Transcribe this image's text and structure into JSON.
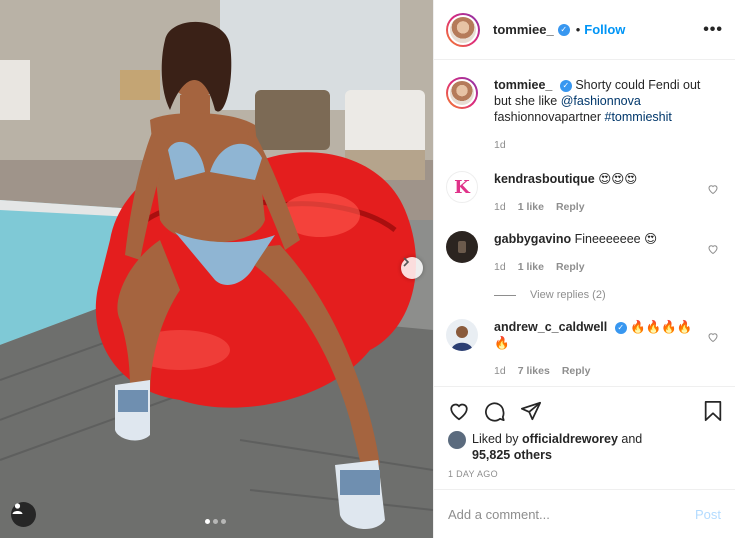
{
  "post": {
    "username": "tommiee_",
    "follow_separator": "•",
    "follow_label": "Follow",
    "more_label": "•••",
    "carousel_dots": 3,
    "carousel_active": 0
  },
  "caption": {
    "username": "tommiee_",
    "text_before": "Shorty could Fendi out but she like ",
    "mention": "@fashionnova",
    "text_after": " fashionnovapartner ",
    "hashtag": "#tommieshit",
    "age": "1d"
  },
  "comments": [
    {
      "username": "kendrasboutique",
      "text": "😍😍😍",
      "age": "1d",
      "likes": "1 like",
      "reply": "Reply",
      "verified": false
    },
    {
      "username": "gabbygavino",
      "text": "Fineeeeeee 😍",
      "age": "1d",
      "likes": "1 like",
      "reply": "Reply",
      "verified": false
    },
    {
      "username": "andrew_c_caldwell",
      "text": "🔥🔥🔥🔥🔥",
      "age": "1d",
      "likes": "7 likes",
      "reply": "Reply",
      "verified": true
    }
  ],
  "view_replies": "View replies (2)",
  "likes": {
    "prefix": "Liked by ",
    "user": "officialdreworey",
    "middle": " and",
    "count": "95,825 others"
  },
  "date": "1 DAY AGO",
  "add_comment": {
    "placeholder": "Add a comment...",
    "post_label": "Post"
  },
  "colors": {
    "accent": "#0095f6",
    "verified": "#3897f0",
    "muted": "#8e8e8e",
    "post_disabled": "#b3dbff"
  },
  "icons": [
    "heart-icon",
    "comment-icon",
    "share-icon",
    "bookmark-icon",
    "chevron-right-icon",
    "user-tag-icon",
    "verified-icon",
    "more-icon"
  ]
}
